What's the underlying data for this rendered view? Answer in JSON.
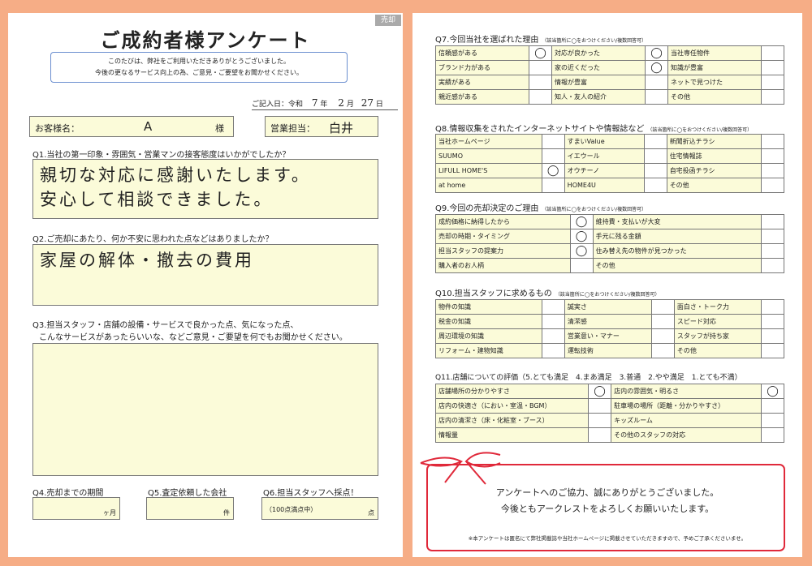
{
  "left": {
    "title": "ご成約者様アンケート",
    "tag": "売却",
    "intro_line1": "このたびは、弊社をご利用いただきありがとうございました。",
    "intro_line2": "今後の更なるサービス向上の為、ご意見・ご要望をお聞かせください。",
    "date_label": "ご記入日：令和",
    "date_year": "7",
    "date_year_unit": "年",
    "date_month": "2",
    "date_month_unit": "月",
    "date_day": "27",
    "date_day_unit": "日",
    "name_label": "お客様名：",
    "name_value": "A",
    "name_suffix": "様",
    "staff_label": "営業担当：",
    "staff_value": "白井",
    "q1": "Q1.当社の第一印象・雰囲気・営業マンの接客態度はいかがでしたか？",
    "q1_line1": "親切な対応に感謝いたします。",
    "q1_line2": "安心して相談できました。",
    "q2": "Q2.ご売却にあたり、何か不安に思われた点などはありましたか？",
    "q2_answer": "家屋の解体・撤去の費用",
    "q3_line1": "Q3.担当スタッフ・店舗の設備・サービスで良かった点、気になった点、",
    "q3_line2": "こんなサービスがあったらいいな、などご意見・ご要望を何でもお聞かせください。",
    "q4": "Q4.売却までの期間",
    "q4_unit": "ヶ月",
    "q5": "Q5.査定依頼した会社",
    "q5_unit": "件",
    "q6": "Q6.担当スタッフへ採点！",
    "q6_note": "（100点満点中）",
    "q6_unit": "点"
  },
  "right": {
    "q7": {
      "head": "Q7.今回当社を選ばれた理由",
      "note": "（該当箇所に◯をおつけください/複数回答可）",
      "rows": [
        [
          {
            "label": "信頼感がある",
            "mark": "◯"
          },
          {
            "label": "対応が良かった",
            "mark": "◯"
          },
          {
            "label": "当社専任物件",
            "mark": ""
          }
        ],
        [
          {
            "label": "ブランド力がある",
            "mark": ""
          },
          {
            "label": "家の近くだった",
            "mark": "◯"
          },
          {
            "label": "知識が豊富",
            "mark": ""
          }
        ],
        [
          {
            "label": "実績がある",
            "mark": ""
          },
          {
            "label": "情報が豊富",
            "mark": ""
          },
          {
            "label": "ネットで見つけた",
            "mark": ""
          }
        ],
        [
          {
            "label": "親近感がある",
            "mark": ""
          },
          {
            "label": "知人・友人の紹介",
            "mark": ""
          },
          {
            "label": "その他",
            "mark": ""
          }
        ]
      ]
    },
    "q8": {
      "head": "Q8.情報収集をされたインターネットサイトや情報誌など",
      "note": "（該当箇所に◯をおつけください/複数回答可）",
      "rows": [
        [
          {
            "label": "当社ホームページ",
            "mark": ""
          },
          {
            "label": "すまいValue",
            "mark": ""
          },
          {
            "label": "新聞折込チラシ",
            "mark": ""
          }
        ],
        [
          {
            "label": "SUUMO",
            "mark": ""
          },
          {
            "label": "イエウール",
            "mark": ""
          },
          {
            "label": "住宅情報誌",
            "mark": ""
          }
        ],
        [
          {
            "label": "LIFULL HOME'S",
            "mark": "◯"
          },
          {
            "label": "オウチーノ",
            "mark": ""
          },
          {
            "label": "自宅投函チラシ",
            "mark": ""
          }
        ],
        [
          {
            "label": "at home",
            "mark": ""
          },
          {
            "label": "HOME4U",
            "mark": ""
          },
          {
            "label": "その他",
            "mark": ""
          }
        ]
      ]
    },
    "q9": {
      "head": "Q9.今回の売却決定のご理由",
      "note": "（該当箇所に◯をおつけください/複数回答可）",
      "rows": [
        [
          {
            "label": "成約価格に納得したから",
            "mark": "◯"
          },
          {
            "label": "維持費・支払いが大変",
            "mark": ""
          }
        ],
        [
          {
            "label": "売却の時期・タイミング",
            "mark": "◯"
          },
          {
            "label": "手元に残る金額",
            "mark": ""
          }
        ],
        [
          {
            "label": "担当スタッフの提案力",
            "mark": "◯"
          },
          {
            "label": "住み替え先の物件が見つかった",
            "mark": ""
          }
        ],
        [
          {
            "label": "購入者のお人柄",
            "mark": ""
          },
          {
            "label": "その他",
            "mark": ""
          }
        ]
      ]
    },
    "q10": {
      "head": "Q10.担当スタッフに求めるもの",
      "note": "（該当箇所に◯をおつけください/複数回答可）",
      "rows": [
        [
          {
            "label": "物件の知識",
            "mark": ""
          },
          {
            "label": "誠実さ",
            "mark": ""
          },
          {
            "label": "面白さ・トーク力",
            "mark": ""
          }
        ],
        [
          {
            "label": "税金の知識",
            "mark": ""
          },
          {
            "label": "清潔感",
            "mark": ""
          },
          {
            "label": "スピード対応",
            "mark": ""
          }
        ],
        [
          {
            "label": "周辺環境の知識",
            "mark": ""
          },
          {
            "label": "営業意い・マナー",
            "mark": ""
          },
          {
            "label": "スタッフが持ち家",
            "mark": ""
          }
        ],
        [
          {
            "label": "リフォーム・建物知識",
            "mark": ""
          },
          {
            "label": "運転技術",
            "mark": ""
          },
          {
            "label": "その他",
            "mark": ""
          }
        ]
      ]
    },
    "q11": {
      "head": "Q11.店舗についての評価（5.とても満足　4.まあ満足　3.普通　2.やや満足　1.とても不満）",
      "rows": [
        [
          {
            "label": "店舗場所の分かりやすさ",
            "mark": "◯"
          },
          {
            "label": "店内の雰囲気・明るさ",
            "mark": "◯"
          }
        ],
        [
          {
            "label": "店内の快適さ（におい・室温・BGM）",
            "mark": ""
          },
          {
            "label": "駐車場の場所（距離・分かりやすさ）",
            "mark": ""
          }
        ],
        [
          {
            "label": "店内の清潔さ（床・化粧室・ブース）",
            "mark": ""
          },
          {
            "label": "キッズルーム",
            "mark": ""
          }
        ],
        [
          {
            "label": "情報量",
            "mark": ""
          },
          {
            "label": "その他のスタッフの対応",
            "mark": ""
          }
        ]
      ]
    },
    "thanks_line1": "アンケートへのご協力、誠にありがとうございました。",
    "thanks_line2": "今後ともアークレストをよろしくお願いいたします。",
    "footnote": "※本アンケートは匿名にて弊社掲載誌や当社ホームページに掲載させていただきますので、予めご了承くださいませ。"
  },
  "colors": {
    "frame": "#f6ad86",
    "field": "#fbfbd9",
    "ribbon": "#e0293a",
    "intro_border": "#6b8fd0"
  }
}
